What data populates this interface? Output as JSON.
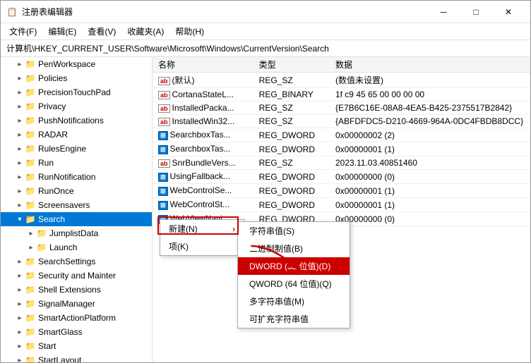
{
  "window": {
    "title": "注册表编辑器",
    "icon": "📋"
  },
  "title_controls": {
    "minimize": "─",
    "maximize": "□",
    "close": "✕"
  },
  "menu_bar": {
    "items": [
      "文件(F)",
      "编辑(E)",
      "查看(V)",
      "收藏夹(A)",
      "帮助(H)"
    ]
  },
  "address_bar": {
    "path": "计算机\\HKEY_CURRENT_USER\\Software\\Microsoft\\Windows\\CurrentVersion\\Search"
  },
  "tree": {
    "items": [
      {
        "label": "PenWorkspace",
        "indent": 1,
        "expanded": false,
        "selected": false
      },
      {
        "label": "Policies",
        "indent": 1,
        "expanded": false,
        "selected": false
      },
      {
        "label": "PrecisionTouchPad",
        "indent": 1,
        "expanded": false,
        "selected": false
      },
      {
        "label": "Privacy",
        "indent": 1,
        "expanded": false,
        "selected": false
      },
      {
        "label": "PushNotifications",
        "indent": 1,
        "expanded": false,
        "selected": false
      },
      {
        "label": "RADAR",
        "indent": 1,
        "expanded": false,
        "selected": false
      },
      {
        "label": "RulesEngine",
        "indent": 1,
        "expanded": false,
        "selected": false
      },
      {
        "label": "Run",
        "indent": 1,
        "expanded": false,
        "selected": false
      },
      {
        "label": "RunNotification",
        "indent": 1,
        "expanded": false,
        "selected": false
      },
      {
        "label": "RunOnce",
        "indent": 1,
        "expanded": false,
        "selected": false
      },
      {
        "label": "Screensavers",
        "indent": 1,
        "expanded": false,
        "selected": false
      },
      {
        "label": "Search",
        "indent": 1,
        "expanded": true,
        "selected": true
      },
      {
        "label": "JumplistData",
        "indent": 2,
        "expanded": false,
        "selected": false
      },
      {
        "label": "Launch",
        "indent": 2,
        "expanded": false,
        "selected": false
      },
      {
        "label": "SearchSettings",
        "indent": 1,
        "expanded": false,
        "selected": false
      },
      {
        "label": "Security and Mainter",
        "indent": 1,
        "expanded": false,
        "selected": false
      },
      {
        "label": "Shell Extensions",
        "indent": 1,
        "expanded": false,
        "selected": false
      },
      {
        "label": "SignalManager",
        "indent": 1,
        "expanded": false,
        "selected": false
      },
      {
        "label": "SmartActionPlatform",
        "indent": 1,
        "expanded": false,
        "selected": false
      },
      {
        "label": "SmartGlass",
        "indent": 1,
        "expanded": false,
        "selected": false
      },
      {
        "label": "Start",
        "indent": 1,
        "expanded": false,
        "selected": false
      },
      {
        "label": "StartLayout",
        "indent": 1,
        "expanded": false,
        "selected": false
      }
    ]
  },
  "table": {
    "columns": [
      "名称",
      "类型",
      "数据"
    ],
    "rows": [
      {
        "name": "ab|(默认)",
        "type": "REG_SZ",
        "data": "(数值未设置)",
        "icon": "ab"
      },
      {
        "name": "ab|CortanaStateL...",
        "type": "REG_BINARY",
        "data": "1f c9 45 65 00 00 00 00",
        "icon": "ab"
      },
      {
        "name": "ab|InstalledPacka...",
        "type": "REG_SZ",
        "data": "{E7B6C16E-08A8-4EA5-B425-2375517B2842}",
        "icon": "ab"
      },
      {
        "name": "ab|InstalledWin32...",
        "type": "REG_SZ",
        "data": "{ABFDFDC5-D210-4669-964A-0DC4FBDB8DCC}",
        "icon": "ab"
      },
      {
        "name": "SearchboxTas...",
        "type": "REG_DWORD",
        "data": "0x00000002 (2)",
        "icon": "dword"
      },
      {
        "name": "SearchboxTas...",
        "type": "REG_DWORD",
        "data": "0x00000001 (1)",
        "icon": "dword"
      },
      {
        "name": "ab|SnrBundleVers...",
        "type": "REG_SZ",
        "data": "2023.11.03.40851460",
        "icon": "ab"
      },
      {
        "name": "UsingFallback...",
        "type": "REG_DWORD",
        "data": "0x00000000 (0)",
        "icon": "dword"
      },
      {
        "name": "WebControlSe...",
        "type": "REG_DWORD",
        "data": "0x00000001 (1)",
        "icon": "dword"
      },
      {
        "name": "WebControlSt...",
        "type": "REG_DWORD",
        "data": "0x00000001 (1)",
        "icon": "dword"
      },
      {
        "name": "WebViewNavi...",
        "type": "REG_DWORD",
        "data": "0x00000000 (0)",
        "icon": "dword"
      }
    ]
  },
  "context_menu": {
    "new_label": "新建(N)",
    "arrow": "›",
    "item_label": "项(K)",
    "submenu_items": [
      {
        "label": "字符串值(S)",
        "highlighted": false
      },
      {
        "label": "二进制制值(B)",
        "highlighted": false
      },
      {
        "label": "DWORD (32 位值)(D)",
        "highlighted": true
      },
      {
        "label": "QWORD (64 位值)(Q)",
        "highlighted": false
      },
      {
        "label": "多字符串值(M)",
        "highlighted": false
      },
      {
        "label": "可扩充字符串值",
        "highlighted": false
      }
    ]
  }
}
